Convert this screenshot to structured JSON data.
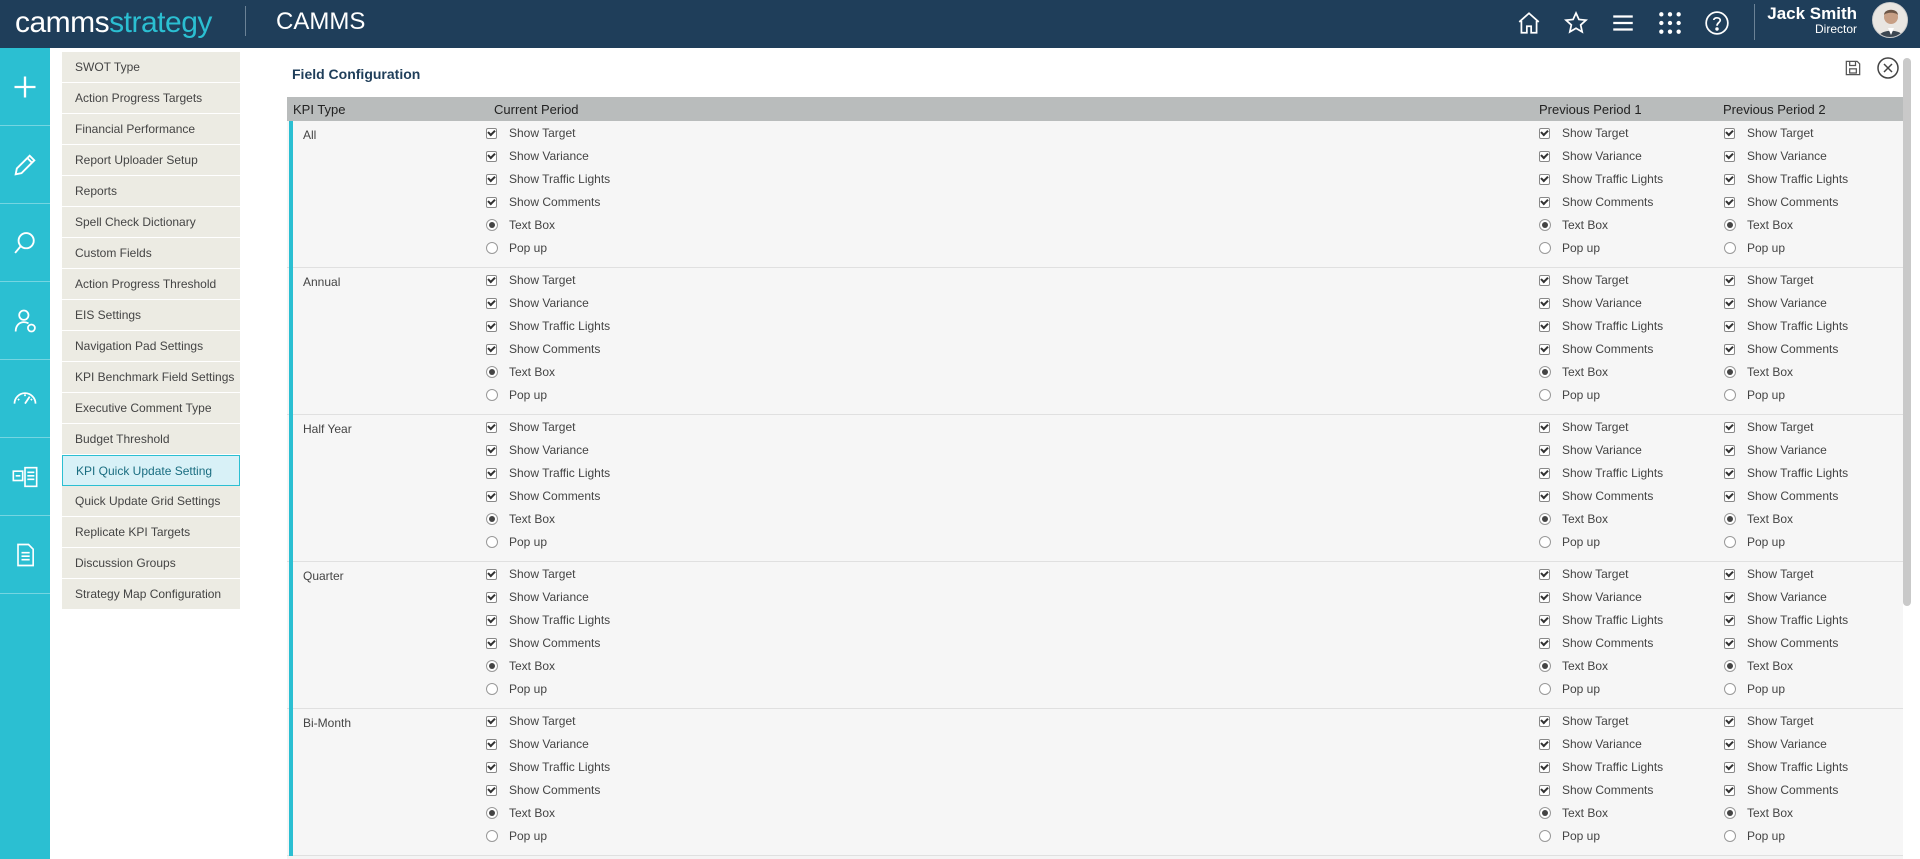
{
  "header": {
    "logo_part1": "camms",
    "logo_part2": "strategy",
    "app_title": "CAMMS",
    "icons": [
      "home-icon",
      "star-icon",
      "menu-icon",
      "apps-grid-icon",
      "help-icon"
    ],
    "user_name": "Jack Smith",
    "user_role": "Director",
    "brand_color": "#2bbfd2",
    "bar_color": "#1f3e5a"
  },
  "rail": {
    "icons": [
      "plus-icon",
      "pencil-icon",
      "search-icon",
      "user-settings-icon",
      "gauge-icon",
      "cards-icon",
      "document-icon"
    ]
  },
  "menu": {
    "items": [
      "SWOT Type",
      "Action Progress Targets",
      "Financial Performance",
      "Report Uploader Setup",
      "Reports",
      "Spell Check Dictionary",
      "Custom Fields",
      "Action Progress Threshold",
      "EIS Settings",
      "Navigation Pad Settings",
      "KPI Benchmark Field Settings",
      "Executive Comment Type",
      "Budget Threshold",
      "KPI Quick Update Setting",
      "Quick Update Grid Settings",
      "Replicate KPI Targets",
      "Discussion Groups",
      "Strategy Map Configuration"
    ],
    "active_item": "KPI Quick Update Setting"
  },
  "panel": {
    "title": "Field Configuration",
    "columns": {
      "kpi_type": "KPI Type",
      "current": "Current Period",
      "prev1": "Previous Period 1",
      "prev2": "Previous Period 2"
    },
    "options": [
      {
        "label": "Show Target",
        "kind": "checkbox",
        "checked": true
      },
      {
        "label": "Show Variance",
        "kind": "checkbox",
        "checked": true
      },
      {
        "label": "Show Traffic Lights",
        "kind": "checkbox",
        "checked": true
      },
      {
        "label": "Show Comments",
        "kind": "checkbox",
        "checked": true
      },
      {
        "label": "Text Box",
        "kind": "radio",
        "checked": true
      },
      {
        "label": "Pop up",
        "kind": "radio",
        "checked": false
      }
    ],
    "rows": [
      "All",
      "Annual",
      "Half Year",
      "Quarter",
      "Bi-Month"
    ]
  }
}
